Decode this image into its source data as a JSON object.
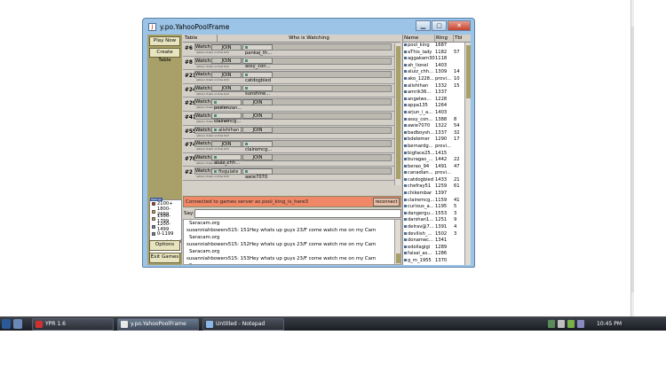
{
  "window": {
    "title": "y.po.YahooPoolFrame"
  },
  "left_panel": {
    "buttons": [
      "Play Now",
      "Create Table"
    ],
    "bottom_buttons": [
      "Options",
      "Exit Games"
    ],
    "legend_header": "Ratings",
    "legend": [
      {
        "label": "2100+",
        "color": "#cc2222"
      },
      {
        "label": "1800-2099",
        "color": "#e0a020"
      },
      {
        "label": "1500-1799",
        "color": "#c8a040"
      },
      {
        "label": "1200-1499",
        "color": "#5a7ac8"
      },
      {
        "label": "0-1199",
        "color": "#7a7a9a"
      },
      {
        "label": "provisional",
        "color": "#3a6a9a"
      }
    ]
  },
  "tables": {
    "col_table": "Table",
    "col_watching": "Who is Watching",
    "watch_label": "Watch",
    "join_label": "JOIN",
    "options_text": "options: 8-ball, no time limit",
    "rows": [
      {
        "num": "#6",
        "seat1": "JOIN",
        "seat2": "pankaj_th..."
      },
      {
        "num": "#8",
        "seat1": "JOIN",
        "seat2": "assy_con..."
      },
      {
        "num": "#21",
        "seat1": "JOIN",
        "seat2": "catdogbied"
      },
      {
        "num": "#24",
        "seat1": "JOIN",
        "seat2": "sunshine..."
      },
      {
        "num": "#29",
        "seat1": "pozlenzan...",
        "seat2": "JOIN"
      },
      {
        "num": "#41",
        "seat1": "clairemcg...",
        "seat2": "JOIN"
      },
      {
        "num": "#55",
        "seat1": "alishihan",
        "seat2": "JOIN"
      },
      {
        "num": "#74",
        "seat1": "JOIN",
        "seat2": "clairemcg..."
      },
      {
        "num": "#78",
        "seat1": "aluiz_chh...",
        "seat2": "JOIN"
      },
      {
        "num": "#2",
        "seat1": "fisquiate",
        "seat2": "awie7070"
      }
    ]
  },
  "status": {
    "message": "Connected to games server as pool_king_is_here3",
    "reconnect_label": "reconnect"
  },
  "say": {
    "label": "Say:"
  },
  "chat": {
    "lines": [
      "Saracam.org",
      "susanniahbowers515: 151Hey whats up guys 23/F come watch me on my Cam",
      "Saracam.org",
      "susanniahbowers515: 152Hey whats up guys 23/F come watch me on my Cam",
      "Saracam.org",
      "susanniahbowers515: 153Hey whats up guys 23/F come watch me on my Cam",
      "Saracam.org",
      "susanniahbowers515: 154Hey whats up guys 23/F come watch me on my Cam",
      "Saracam.org"
    ]
  },
  "users": {
    "col_name": "Name",
    "col_rating": "Rtng",
    "col_tbl": "Tbl",
    "rows": [
      {
        "name": "pool_king",
        "rating": "1687",
        "tbl": ""
      },
      {
        "name": "aThis_lady",
        "rating": "1182",
        "tbl": "57"
      },
      {
        "name": "aggakam30",
        "rating": "1118",
        "tbl": ""
      },
      {
        "name": "ah_lionel",
        "rating": "1403",
        "tbl": ""
      },
      {
        "name": "aluiz_chh...",
        "rating": "1309",
        "tbl": "14"
      },
      {
        "name": "ako_1228...",
        "rating": "provi...",
        "tbl": "10"
      },
      {
        "name": "alishihan",
        "rating": "1332",
        "tbl": "15"
      },
      {
        "name": "amrik36...",
        "rating": "1337",
        "tbl": ""
      },
      {
        "name": "angelws...",
        "rating": "1228",
        "tbl": ""
      },
      {
        "name": "appa135",
        "rating": "1264",
        "tbl": ""
      },
      {
        "name": "arjun_i_a...",
        "rating": "1403",
        "tbl": ""
      },
      {
        "name": "assy_con...",
        "rating": "1388",
        "tbl": "8"
      },
      {
        "name": "awie7070",
        "rating": "1322",
        "tbl": "54"
      },
      {
        "name": "badboysh...",
        "rating": "1337",
        "tbl": "32"
      },
      {
        "name": "bdelemer",
        "rating": "1290",
        "tbl": "17"
      },
      {
        "name": "bernardg...",
        "rating": "provi...",
        "tbl": ""
      },
      {
        "name": "bigface25...",
        "rating": "1415",
        "tbl": ""
      },
      {
        "name": "buragas_...",
        "rating": "1442",
        "tbl": "22"
      },
      {
        "name": "berao_94",
        "rating": "1491",
        "tbl": "47"
      },
      {
        "name": "canadian...",
        "rating": "provi...",
        "tbl": ""
      },
      {
        "name": "catdogbied",
        "rating": "1433",
        "tbl": "21"
      },
      {
        "name": "chefray51",
        "rating": "1259",
        "tbl": "61"
      },
      {
        "name": "chikembar",
        "rating": "1397",
        "tbl": ""
      },
      {
        "name": "clairemcg...",
        "rating": "1159",
        "tbl": "41"
      },
      {
        "name": "curious_a...",
        "rating": "1195",
        "tbl": "5"
      },
      {
        "name": "dangergu...",
        "rating": "1553",
        "tbl": "3"
      },
      {
        "name": "darshan1...",
        "rating": "1251",
        "tbl": "9"
      },
      {
        "name": "delrav@7...",
        "rating": "1391",
        "tbl": "4"
      },
      {
        "name": "devilish_...",
        "rating": "1502",
        "tbl": "3"
      },
      {
        "name": "donamec...",
        "rating": "1341",
        "tbl": ""
      },
      {
        "name": "edollagigi",
        "rating": "1289",
        "tbl": ""
      },
      {
        "name": "faisal_as...",
        "rating": "1286",
        "tbl": ""
      },
      {
        "name": "g_m_1955",
        "rating": "1370",
        "tbl": ""
      }
    ]
  },
  "taskbar": {
    "items": [
      "YPR 1.6",
      "y.po.YahooPoolFrame",
      "Untitled - Notepad"
    ],
    "clock": "10:45 PM"
  }
}
